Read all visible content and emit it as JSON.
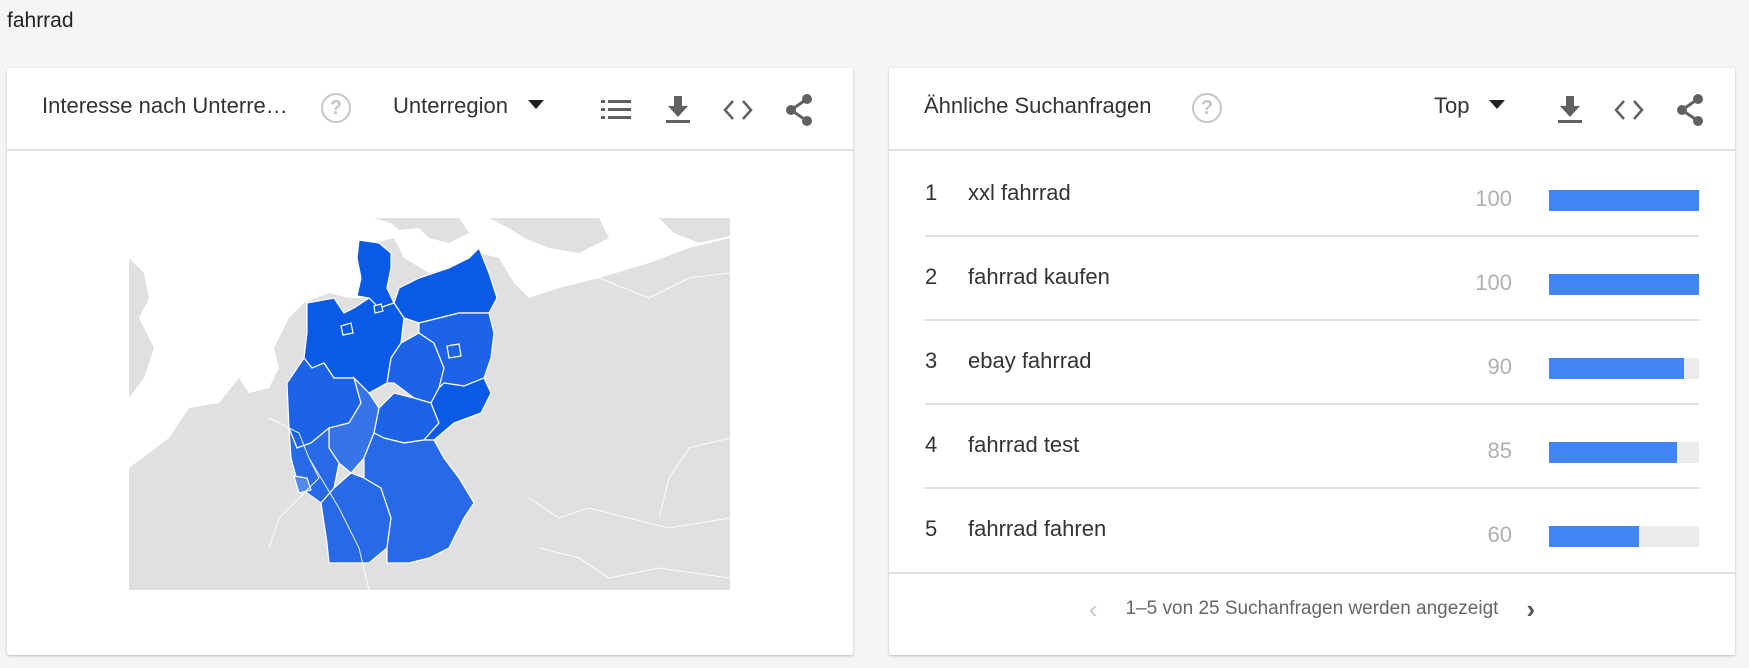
{
  "page": {
    "title": "fahrrad"
  },
  "left_card": {
    "title": "Interesse nach Unterre…",
    "help_icon": "help-circle-icon",
    "dropdown": {
      "selected": "Unterregion"
    },
    "icons": [
      "list-icon",
      "download-icon",
      "embed-code-icon",
      "share-icon"
    ],
    "map": {
      "region": "Deutschland",
      "colors": {
        "land_other": "#e0e0e0",
        "water": "#ffffff",
        "border": "#ffffff",
        "state_dark": "#0a5ae8",
        "state_mid": "#1c63e8",
        "state_light": "#2869e6",
        "state_lighter": "#3674e8",
        "state_lightest": "#5189ec"
      }
    }
  },
  "right_card": {
    "title": "Ähnliche Suchanfragen",
    "help_icon": "help-circle-icon",
    "dropdown": {
      "selected": "Top"
    },
    "icons": [
      "download-icon",
      "embed-code-icon",
      "share-icon"
    ],
    "bar_color": "#4285f4",
    "rows": [
      {
        "rank": "1",
        "query": "xxl fahrrad",
        "value": "100",
        "fraction": 1.0
      },
      {
        "rank": "2",
        "query": "fahrrad kaufen",
        "value": "100",
        "fraction": 1.0
      },
      {
        "rank": "3",
        "query": "ebay fahrrad",
        "value": "90",
        "fraction": 0.9
      },
      {
        "rank": "4",
        "query": "fahrrad test",
        "value": "85",
        "fraction": 0.85
      },
      {
        "rank": "5",
        "query": "fahrrad fahren",
        "value": "60",
        "fraction": 0.6
      }
    ],
    "pagination": {
      "text": "1–5 von 25 Suchanfragen werden angezeigt",
      "prev": "‹",
      "next": "›"
    }
  }
}
